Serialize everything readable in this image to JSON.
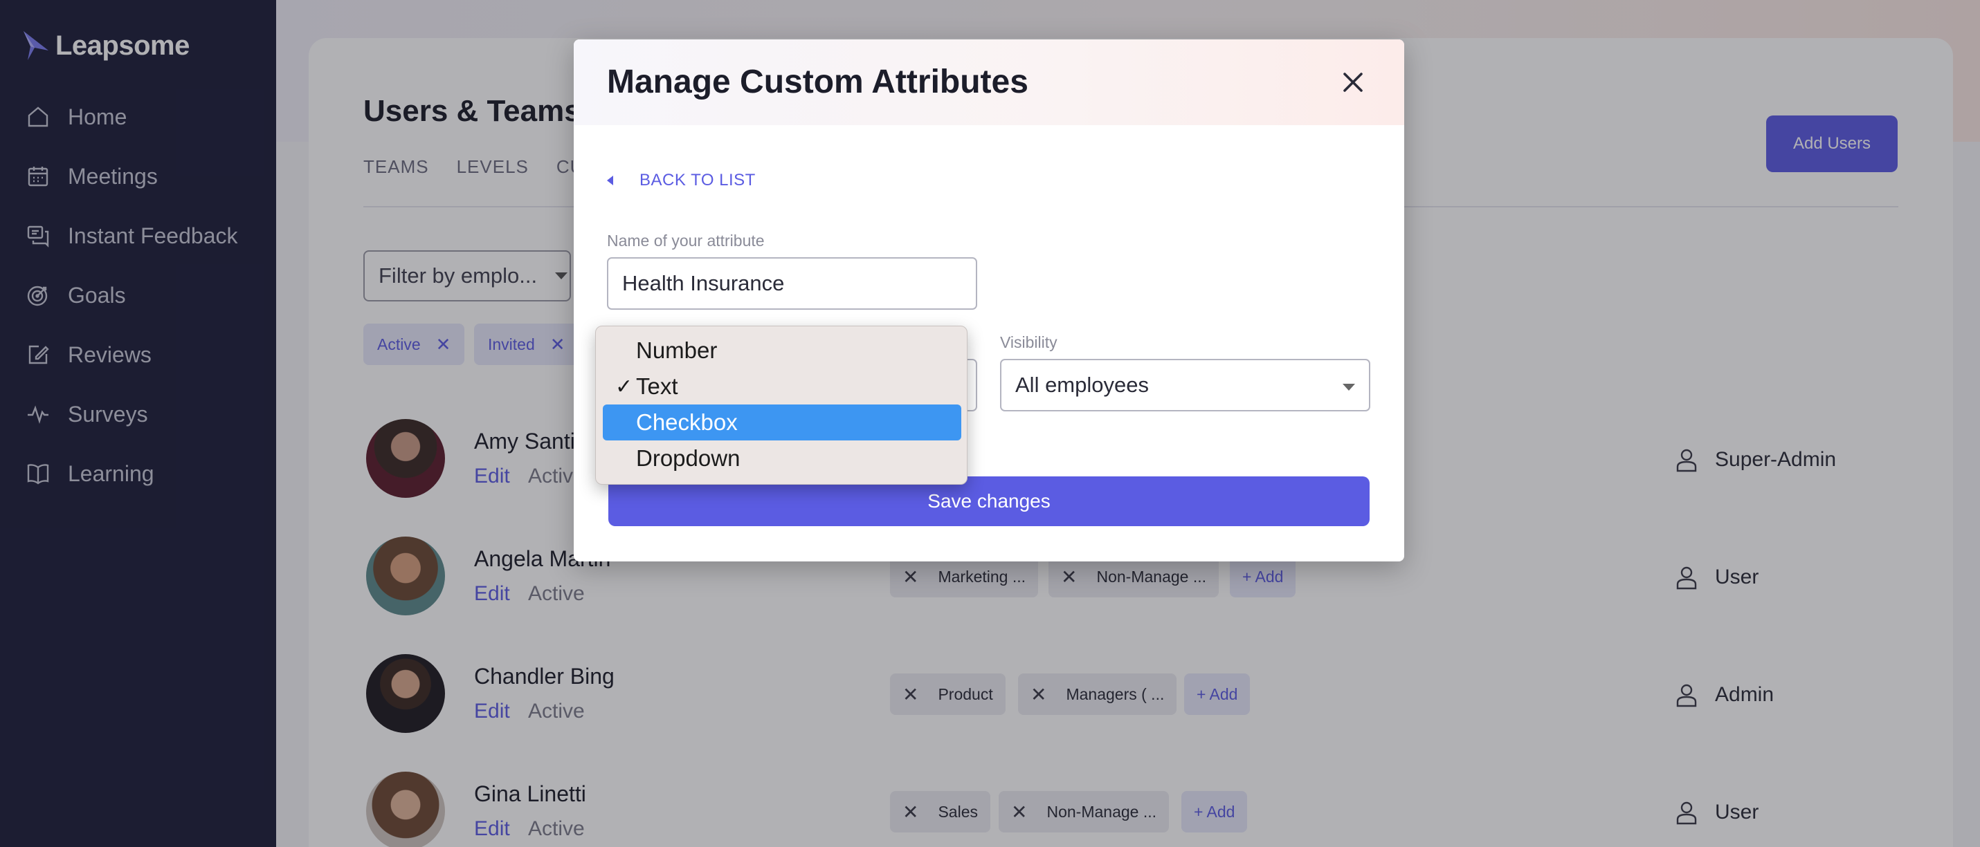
{
  "app": {
    "name": "Leapsome"
  },
  "sidebar": {
    "items": [
      {
        "label": "Home",
        "icon": "home-icon"
      },
      {
        "label": "Meetings",
        "icon": "calendar-icon"
      },
      {
        "label": "Instant Feedback",
        "icon": "feedback-icon"
      },
      {
        "label": "Goals",
        "icon": "target-icon"
      },
      {
        "label": "Reviews",
        "icon": "edit-icon"
      },
      {
        "label": "Surveys",
        "icon": "pulse-icon"
      },
      {
        "label": "Learning",
        "icon": "book-icon"
      }
    ]
  },
  "page": {
    "title": "Users & Teams",
    "tabs": [
      "TEAMS",
      "LEVELS",
      "CUS"
    ],
    "add_users_label": "Add Users",
    "filter_placeholder": "Filter by emplo...",
    "status_chips": [
      "Active",
      "Invited"
    ]
  },
  "users": [
    {
      "name": "Amy Santi",
      "edit": "Edit",
      "status": "Active",
      "role": "Super-Admin",
      "tags": [],
      "add_label": ""
    },
    {
      "name": "Angela Martin",
      "edit": "Edit",
      "status": "Active",
      "role": "User",
      "tags": [
        "Marketing ...",
        "Non-Manage ..."
      ],
      "add_label": "+ Add"
    },
    {
      "name": "Chandler Bing",
      "edit": "Edit",
      "status": "Active",
      "role": "Admin",
      "tags": [
        "Product",
        "Managers ( ..."
      ],
      "add_label": "+ Add"
    },
    {
      "name": "Gina Linetti",
      "edit": "Edit",
      "status": "Active",
      "role": "User",
      "tags": [
        "Sales",
        "Non-Manage ..."
      ],
      "add_label": "+ Add"
    }
  ],
  "modal": {
    "title": "Manage Custom Attributes",
    "back_label": "BACK TO LIST",
    "name_label": "Name of your attribute",
    "name_value": "Health Insurance",
    "visibility_label": "Visibility",
    "visibility_value": "All employees",
    "save_label": "Save changes"
  },
  "type_menu": {
    "options": [
      "Number",
      "Text",
      "Checkbox",
      "Dropdown"
    ],
    "checked": "Text",
    "highlighted": "Checkbox",
    "check_glyph": "✓"
  },
  "colors": {
    "sidebar_bg": "#1d1f3b",
    "accent": "#5b5ce2",
    "menu_highlight": "#3d96f2"
  }
}
